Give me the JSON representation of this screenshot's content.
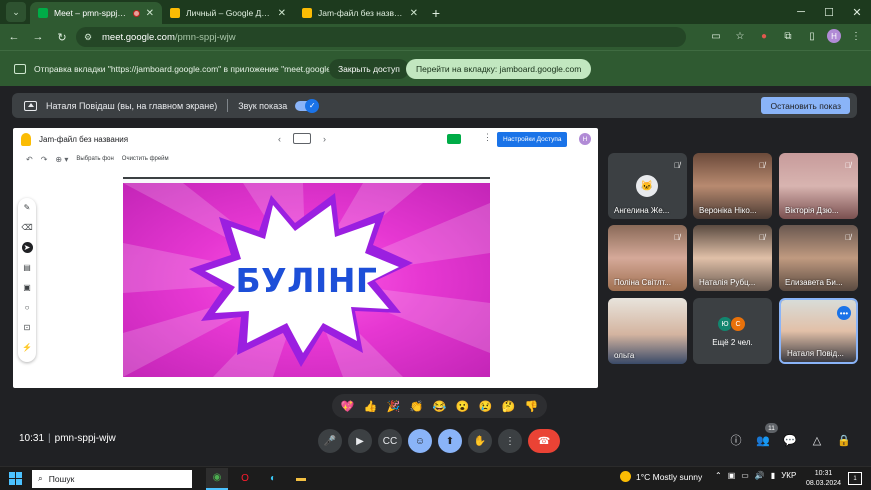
{
  "browser": {
    "tabs": [
      {
        "title": "Meet – pmn-sppj-wjw",
        "active": true,
        "favicon_color": "#00ac47"
      },
      {
        "title": "Личный – Google Диск",
        "active": false,
        "favicon_color": "#fbbc04"
      },
      {
        "title": "Jam-файл без названия – G",
        "active": false,
        "favicon_color": "#fbbc04"
      }
    ],
    "url_host": "meet.google.com",
    "url_path": "/pmn-sppj-wjw",
    "profile_initial": "Н"
  },
  "infobar": {
    "text": "Отправка вкладки \"https://jamboard.google.com\" в приложение \"meet.google.com\"...",
    "stop_label": "Закрыть доступ",
    "switch_label": "Перейти на вкладку: jamboard.google.com"
  },
  "presenting": {
    "label": "Наталя Повідаш (вы, на главном экране)",
    "sound_label": "Звук показа",
    "stop_label": "Остановить показ"
  },
  "jamboard": {
    "title": "Jam-файл без названия",
    "share_label": "Настройки Доступа",
    "avatar_initial": "Н",
    "bg_label": "Выбрать фон",
    "clear_label": "Очистить фрейм",
    "slide_text": "БУЛІНГ",
    "colors": {
      "slide": "#e637d2",
      "burst": "#9b1fe0",
      "text": "#1d4fd8"
    }
  },
  "participants": [
    {
      "name": "Ангелина Же...",
      "avatar": "icon"
    },
    {
      "name": "Вероніка Ніко...",
      "avatar": "photo"
    },
    {
      "name": "Вікторія Дзю...",
      "avatar": "photo"
    },
    {
      "name": "Поліна Світлт...",
      "avatar": "photo"
    },
    {
      "name": "Наталія Рубц...",
      "avatar": "photo"
    },
    {
      "name": "Елизавета Би...",
      "avatar": "photo"
    },
    {
      "name": "ольга",
      "avatar": "photo"
    },
    {
      "name": "Ещё 2 чел.",
      "avatar": "initials",
      "initials": [
        "Ю",
        "С"
      ]
    },
    {
      "name": "Наталя Повід...",
      "avatar": "photo"
    }
  ],
  "reactions": [
    "💖",
    "👍",
    "🎉",
    "👏",
    "😂",
    "😮",
    "😢",
    "🤔",
    "👎"
  ],
  "meeting": {
    "time": "10:31",
    "code": "pmn-sppj-wjw",
    "participants_count": "11"
  },
  "taskbar": {
    "search_placeholder": "Пошук",
    "weather": "1°C  Mostly sunny",
    "lang": "УКР",
    "time": "10:31",
    "date": "08.03.2024"
  }
}
